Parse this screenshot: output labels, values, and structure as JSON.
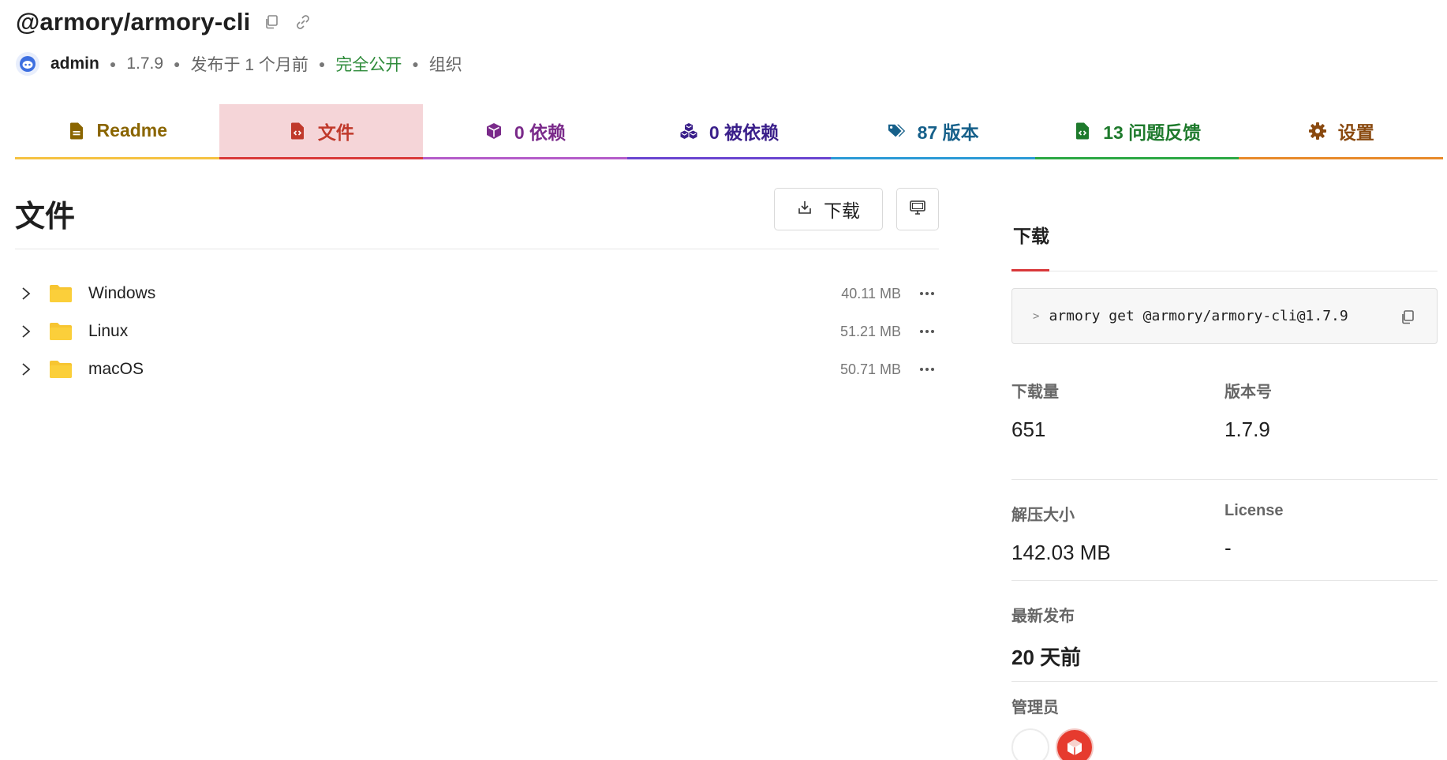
{
  "package": {
    "name": "@armory/armory-cli",
    "copy_icon": "copy-icon",
    "link_icon": "link-icon"
  },
  "meta": {
    "user": "admin",
    "version": "1.7.9",
    "published": "发布于 1 个月前",
    "visibility": "完全公开",
    "scope": "组织"
  },
  "tabs": [
    {
      "label": "Readme",
      "icon": "file-text-icon",
      "color": "#8a6500",
      "underline": "#f5c242",
      "active": false
    },
    {
      "label": "文件",
      "icon": "file-code-icon",
      "color": "#c0392b",
      "underline": "#d93a3a",
      "active": true
    },
    {
      "label": "0 依赖",
      "icon": "cube-icon",
      "color": "#7a2a8a",
      "underline": "#b45cc9",
      "active": false
    },
    {
      "label": "0 被依赖",
      "icon": "cubes-icon",
      "color": "#3a1f8a",
      "underline": "#6a45d0",
      "active": false
    },
    {
      "label": "87 版本",
      "icon": "tags-icon",
      "color": "#16608a",
      "underline": "#2b9ad6",
      "active": false
    },
    {
      "label": "13 问题反馈",
      "icon": "file-code-green-icon",
      "color": "#1e7a2c",
      "underline": "#2ca844",
      "active": false
    },
    {
      "label": "设置",
      "icon": "gear-icon",
      "color": "#8a4a10",
      "underline": "#e88a2a",
      "active": false
    }
  ],
  "files": {
    "title": "文件",
    "download_button": "下载",
    "rows": [
      {
        "name": "Windows",
        "size": "40.11 MB"
      },
      {
        "name": "Linux",
        "size": "51.21 MB"
      },
      {
        "name": "macOS",
        "size": "50.71 MB"
      }
    ]
  },
  "sidebar": {
    "tab_title": "下载",
    "command": "armory get @armory/armory-cli@1.7.9",
    "downloads_label": "下载量",
    "downloads_value": "651",
    "version_label": "版本号",
    "version_value": "1.7.9",
    "unpacked_label": "解压大小",
    "unpacked_value": "142.03 MB",
    "license_label": "License",
    "license_value": "-",
    "latest_label": "最新发布",
    "latest_value": "20 天前",
    "managers_label": "管理员"
  },
  "colors": {
    "accent_red": "#d93a3a",
    "folder": "#f7c531",
    "public_green": "#2e8b3a"
  }
}
